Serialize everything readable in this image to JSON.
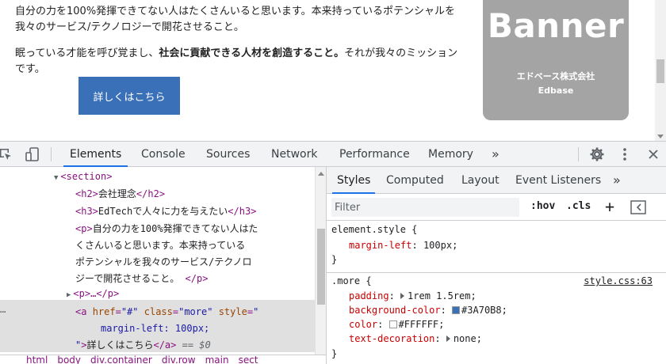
{
  "page": {
    "paragraph1": "自分の力を100%発揮できてない人はたくさんいると思います。本来持っているポテンシャルを我々のサービス/テクノロジーで開花させること。",
    "paragraph2_pre": "眠っている才能を呼び覚まし、",
    "paragraph2_bold": "社会に貢献できる人材を創造すること。",
    "paragraph2_post": "それが我々のミッションです。",
    "cta_label": "詳しくはこちら",
    "banner": {
      "title": "Banner",
      "company": "エドベース株式会社",
      "company_en": "Edbase"
    }
  },
  "devtools": {
    "tabs": [
      "Elements",
      "Console",
      "Sources",
      "Network",
      "Performance",
      "Memory"
    ],
    "more_tabs": "»",
    "active_tab": "Elements",
    "elements": {
      "section_tag": "<section>",
      "h2_open": "<h2>",
      "h2_text": "会社理念",
      "h2_close": "</h2>",
      "h3_open": "<h3>",
      "h3_text": "EdTechで人々に力を与えたい",
      "h3_close": "</h3>",
      "p_open": "<p>",
      "p_text_lines": [
        "自分の力を100%発揮できてない人はた",
        "くさんいると思います。本来持っている",
        "ポテンシャルを我々のサービス/テクノロ",
        "ジーで開花させること。 "
      ],
      "p_close": "</p>",
      "p_collapsed": "<p>…</p>",
      "a_tag_open": "<a ",
      "a_href_name": "href",
      "a_href_val": "\"#\"",
      "a_class_name": "class",
      "a_class_val": "\"more\"",
      "a_style_name": "style",
      "a_style_val_open": "\"",
      "a_style_content": "margin-left: 100px;",
      "a_style_val_close": "\"",
      "a_close_bracket": ">",
      "a_text": "詳しくはこちら",
      "a_close": "</a>",
      "eq_zero": " == $0",
      "breadcrumb": [
        "html",
        "body",
        "div.container",
        "div.row",
        "main",
        "sect"
      ]
    },
    "styles": {
      "sub_tabs": [
        "Styles",
        "Computed",
        "Layout",
        "Event Listeners"
      ],
      "sub_more": "»",
      "active_sub_tab": "Styles",
      "filter_placeholder": "Filter",
      "hov": ":hov",
      "cls": ".cls",
      "plus": "+",
      "element_style_selector": "element.style {",
      "element_style_props": [
        {
          "name": "margin-left",
          "value": "100px"
        }
      ],
      "closing_brace": "}",
      "more_selector": ".more {",
      "more_source": "style.css:63",
      "more_props": [
        {
          "name": "padding",
          "value": "1rem 1.5rem",
          "expandable": true
        },
        {
          "name": "background-color",
          "value": "#3A70B8",
          "swatch": "#3A70B8"
        },
        {
          "name": "color",
          "value": "#FFFFFF",
          "swatch": "#FFFFFF"
        },
        {
          "name": "text-decoration",
          "value": "none",
          "expandable": true
        }
      ]
    }
  },
  "colors": {
    "accent": "#1a73e8",
    "cta": "#3A70B8",
    "banner": "#a4a4a4"
  }
}
